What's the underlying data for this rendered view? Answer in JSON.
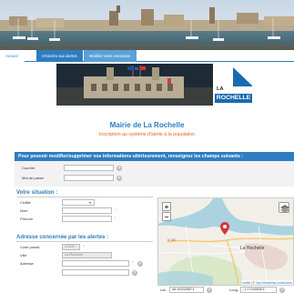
{
  "tabs": {
    "accueil": "Accueil",
    "alertes": "S'inscrire aux alertes",
    "modifier": "Modifier votre inscription"
  },
  "brand": {
    "la": "LA",
    "rochelle": "ROCHELLE"
  },
  "header": {
    "title": "Mairie de La Rochelle",
    "subtitle": "Inscription au système d'alerte à la population"
  },
  "login_section": {
    "heading": "Pour pouvoir modifier/supprimer vos informations ultérieurement, renseignez les champs suivants :",
    "courriel_label": "Courriel",
    "motdepasse_label": "Mot de passe",
    "courriel_value": "",
    "motdepasse_value": ""
  },
  "situation": {
    "heading": "Votre situation :",
    "civilite_label": "Civilité",
    "nom_label": "Nom",
    "prenom_label": "Prénom",
    "civilite_value": "",
    "nom_value": "",
    "prenom_value": ""
  },
  "adresse": {
    "heading": "Adresse concernée par les alertes :",
    "cp_label": "Code postal",
    "ville_label": "Ville",
    "adresse_label": "Adresse",
    "cp_value": "17000",
    "ville_value": "La Rochelle",
    "adresse_value": "",
    "adresse2_value": ""
  },
  "map": {
    "city_label": "La Rochelle",
    "attribution_leaflet": "Leaflet",
    "attribution_sep": " | © ",
    "attribution_osm": "OpenStreetMap contributors",
    "road_label": "D 105"
  },
  "coords": {
    "lat_label": "Lat.",
    "lat_value": "46.162026671",
    "long_label": "Long.",
    "long_value": "-1.170408303"
  },
  "symbols": {
    "help": "?",
    "star": "*",
    "zoom_in": "+",
    "zoom_out": "−",
    "select_arrow": "▾"
  }
}
